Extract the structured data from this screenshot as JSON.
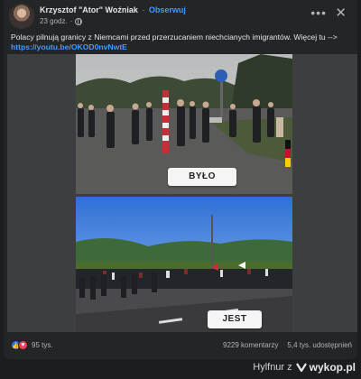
{
  "post": {
    "author": "Krzysztof \"Ator\" Woźniak",
    "separator": "·",
    "follow_label": "Obserwuj",
    "time": "23 godz.",
    "text": "Polacy pilnują granicy z Niemcami przed przerzucaniem niechcianych imigrantów. Więcej tu -->",
    "link": "https://youtu.be/OKOD0nvNwtE",
    "more_icon": "more-icon",
    "close_icon": "close-icon"
  },
  "media": {
    "top_stamp": "BYŁO",
    "bottom_stamp": "JEST"
  },
  "footer": {
    "reaction_count": "95 tys.",
    "comments": "9229 komentarzy",
    "shares": "5,4 tys. udostępnień"
  },
  "watermark": {
    "prefix": "Hylfnur z",
    "brand": "wykop.pl"
  }
}
